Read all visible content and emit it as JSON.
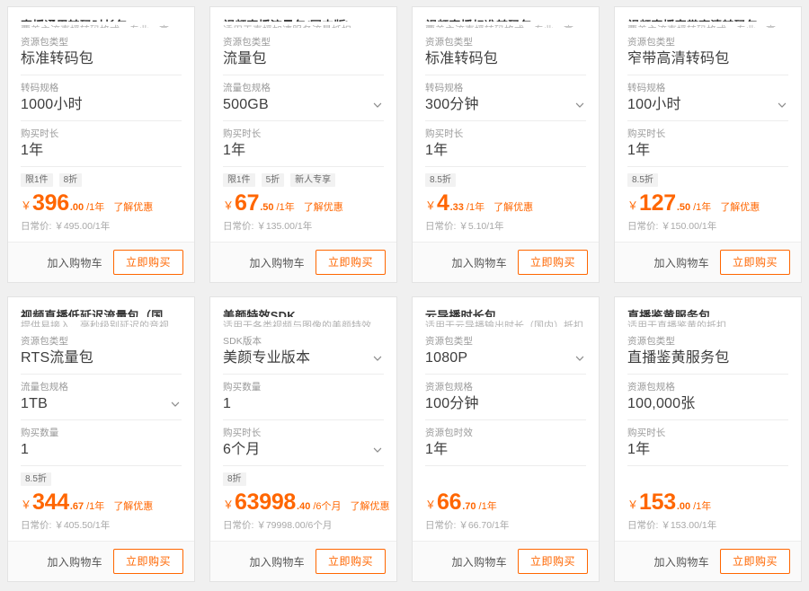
{
  "common": {
    "add_to_cart_label": "加入购物车",
    "buy_now_label": "立即购买",
    "promo_link_label": "了解优惠",
    "currency_symbol": "￥",
    "original_price_prefix": "日常价:",
    "chevron_icon": "chevron-down-icon"
  },
  "cards": [
    {
      "title": "直播通用转码时长包",
      "subtitle": "覆盖主流直播转码格式，专业，高可定制转码...",
      "fields": [
        {
          "label": "资源包类型",
          "value": "标准转码包",
          "has_chevron": false
        },
        {
          "label": "转码规格",
          "value": "1000小时",
          "has_chevron": false
        },
        {
          "label": "购买时长",
          "value": "1年",
          "has_chevron": false
        }
      ],
      "badges": [
        "限1件",
        "8折"
      ],
      "price_int": "396",
      "price_dec": ".00",
      "price_unit": "/1年",
      "show_promo": true,
      "original_price": "日常价: ￥495.00/1年"
    },
    {
      "title": "视频直播流量包(国内版)",
      "subtitle": "适用于直播加速服务流量抵扣",
      "fields": [
        {
          "label": "资源包类型",
          "value": "流量包",
          "has_chevron": false
        },
        {
          "label": "流量包规格",
          "value": "500GB",
          "has_chevron": true
        },
        {
          "label": "购买时长",
          "value": "1年",
          "has_chevron": false
        }
      ],
      "badges": [
        "限1件",
        "5折",
        "新人专享"
      ],
      "price_int": "67",
      "price_dec": ".50",
      "price_unit": "/1年",
      "show_promo": true,
      "original_price": "日常价: ￥135.00/1年"
    },
    {
      "title": "视频直播标准转码包",
      "subtitle": "覆盖主流直播转码格式，专业，高可定制转码...",
      "fields": [
        {
          "label": "资源包类型",
          "value": "标准转码包",
          "has_chevron": false
        },
        {
          "label": "转码规格",
          "value": "300分钟",
          "has_chevron": true
        },
        {
          "label": "购买时长",
          "value": "1年",
          "has_chevron": false
        }
      ],
      "badges": [
        "8.5折"
      ],
      "price_int": "4",
      "price_dec": ".33",
      "price_unit": "/1年",
      "show_promo": true,
      "original_price": "日常价: ￥5.10/1年"
    },
    {
      "title": "视频直播窄带高清转码包",
      "subtitle": "覆盖主流直播转码格式，专业，高可定制转码...",
      "fields": [
        {
          "label": "资源包类型",
          "value": "窄带高清转码包",
          "has_chevron": false
        },
        {
          "label": "转码规格",
          "value": "100小时",
          "has_chevron": true
        },
        {
          "label": "购买时长",
          "value": "1年",
          "has_chevron": false
        }
      ],
      "badges": [
        "8.5折"
      ],
      "price_int": "127",
      "price_dec": ".50",
      "price_unit": "/1年",
      "show_promo": true,
      "original_price": "日常价: ￥150.00/1年"
    },
    {
      "title": "视频直播低延迟流量包（国内版）",
      "subtitle": "提供易接入、毫秒级别延迟的音视频直播服务",
      "fields": [
        {
          "label": "资源包类型",
          "value": "RTS流量包",
          "has_chevron": false
        },
        {
          "label": "流量包规格",
          "value": "1TB",
          "has_chevron": true
        },
        {
          "label": "购买数量",
          "value": "1",
          "has_chevron": false
        }
      ],
      "badges": [
        "8.5折"
      ],
      "price_int": "344",
      "price_dec": ".67",
      "price_unit": "/1年",
      "show_promo": true,
      "original_price": "日常价: ￥405.50/1年"
    },
    {
      "title": "美颜特效SDK",
      "subtitle": "适用于各类视频与图像的美颜特效处理",
      "fields": [
        {
          "label": "SDK版本",
          "value": "美颜专业版本",
          "has_chevron": true
        },
        {
          "label": "购买数量",
          "value": "1",
          "has_chevron": false
        },
        {
          "label": "购买时长",
          "value": "6个月",
          "has_chevron": true
        }
      ],
      "badges": [
        "8折"
      ],
      "price_int": "63998",
      "price_dec": ".40",
      "price_unit": "/6个月",
      "show_promo": true,
      "original_price": "日常价: ￥79998.00/6个月"
    },
    {
      "title": "云导播时长包",
      "subtitle": "适用于云导播输出时长（国内）抵扣",
      "fields": [
        {
          "label": "资源包类型",
          "value": "1080P",
          "has_chevron": true
        },
        {
          "label": "资源包规格",
          "value": "100分钟",
          "has_chevron": false
        },
        {
          "label": "资源包时效",
          "value": "1年",
          "has_chevron": false
        }
      ],
      "badges": [],
      "price_int": "66",
      "price_dec": ".70",
      "price_unit": "/1年",
      "show_promo": false,
      "original_price": "日常价: ￥66.70/1年"
    },
    {
      "title": "直播鉴黄服务包",
      "subtitle": "适用于直播鉴黄的抵扣",
      "fields": [
        {
          "label": "资源包类型",
          "value": "直播鉴黄服务包",
          "has_chevron": false
        },
        {
          "label": "资源包规格",
          "value": "100,000张",
          "has_chevron": false
        },
        {
          "label": "购买时长",
          "value": "1年",
          "has_chevron": false
        }
      ],
      "badges": [],
      "price_int": "153",
      "price_dec": ".00",
      "price_unit": "/1年",
      "show_promo": false,
      "original_price": "日常价: ￥153.00/1年"
    }
  ]
}
